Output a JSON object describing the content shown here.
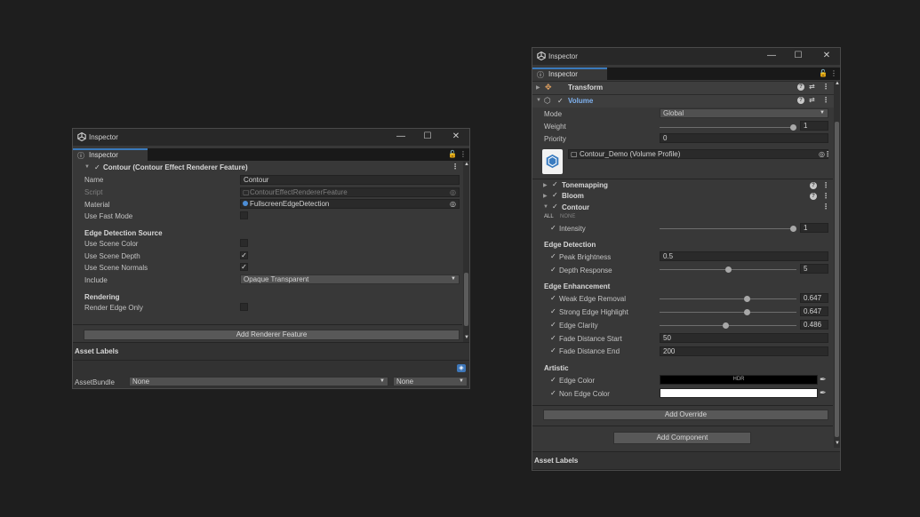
{
  "left": {
    "title": "Inspector",
    "tab": "Inspector",
    "header": "Contour (Contour Effect Renderer Feature)",
    "name_label": "Name",
    "name_value": "Contour",
    "script_label": "Script",
    "script_value": "ContourEffectRendererFeature",
    "material_label": "Material",
    "material_value": "FullscreenEdgeDetection",
    "fast_mode_label": "Use Fast Mode",
    "section_edge": "Edge Detection Source",
    "scene_color": "Use Scene Color",
    "scene_depth": "Use Scene Depth",
    "scene_normals": "Use Scene Normals",
    "include_label": "Include",
    "include_value": "Opaque Transparent",
    "section_render": "Rendering",
    "render_edge_only": "Render Edge Only",
    "add_feature": "Add Renderer Feature",
    "asset_labels": "Asset Labels",
    "asset_bundle": "AssetBundle",
    "bundle_value": "None",
    "variant_value": "None"
  },
  "right": {
    "title": "Inspector",
    "tab": "Inspector",
    "transform": "Transform",
    "volume": "Volume",
    "mode_label": "Mode",
    "mode_value": "Global",
    "weight_label": "Weight",
    "weight_value": "1",
    "weight_fraction": 1.0,
    "priority_label": "Priority",
    "priority_value": "0",
    "profile_value": "Contour_Demo (Volume Profile)",
    "tonemapping": "Tonemapping",
    "bloom": "Bloom",
    "contour": "Contour",
    "all": "ALL",
    "none": "NONE",
    "intensity_label": "Intensity",
    "intensity_value": "1",
    "intensity_fraction": 1.0,
    "section_detect": "Edge Detection",
    "peak_label": "Peak Brightness",
    "peak_value": "0.5",
    "depth_label": "Depth Response",
    "depth_value": "5",
    "depth_fraction": 0.5,
    "section_enh": "Edge Enhancement",
    "weak_label": "Weak Edge Removal",
    "weak_value": "0.647",
    "weak_fraction": 0.647,
    "strong_label": "Strong Edge Highlight",
    "strong_value": "0.647",
    "strong_fraction": 0.647,
    "clarity_label": "Edge Clarity",
    "clarity_value": "0.486",
    "clarity_fraction": 0.486,
    "fstart_label": "Fade Distance Start",
    "fstart_value": "50",
    "fend_label": "Fade Distance End",
    "fend_value": "200",
    "section_art": "Artistic",
    "edge_color_label": "Edge Color",
    "edge_color_hdr": "HDR",
    "edge_color": "#000000",
    "non_edge_label": "Non Edge Color",
    "non_edge_color": "#ffffff",
    "add_override": "Add Override",
    "add_component": "Add Component",
    "asset_labels": "Asset Labels"
  }
}
